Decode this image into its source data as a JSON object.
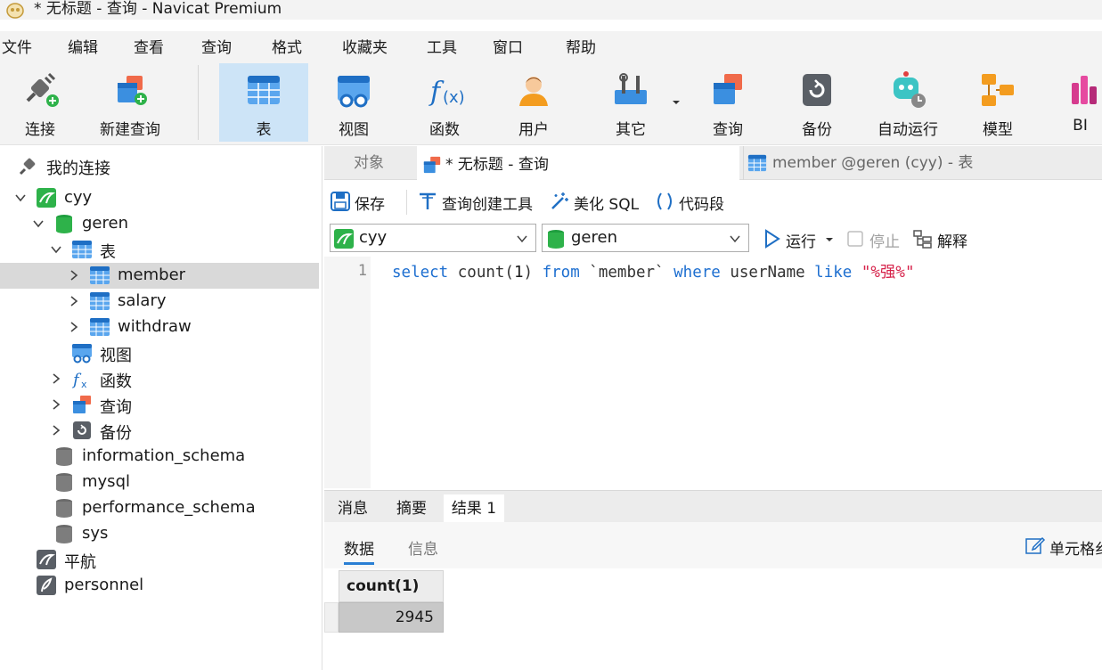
{
  "window": {
    "title": "* 无标题 - 查询 - Navicat Premium"
  },
  "menu": [
    "文件",
    "编辑",
    "查看",
    "查询",
    "格式",
    "收藏夹",
    "工具",
    "窗口",
    "帮助"
  ],
  "toolbar": {
    "connect": "连接",
    "new_query": "新建查询",
    "table": "表",
    "view": "视图",
    "function": "函数",
    "user": "用户",
    "other": "其它",
    "query": "查询",
    "backup": "备份",
    "automation": "自动运行",
    "model": "模型",
    "bi": "BI"
  },
  "sidebar": {
    "header": "我的连接",
    "connection": "cyy",
    "database": "geren",
    "tables_group": "表",
    "tables": [
      "member",
      "salary",
      "withdraw"
    ],
    "views": "视图",
    "functions": "函数",
    "queries": "查询",
    "backups": "备份",
    "other_dbs": [
      "information_schema",
      "mysql",
      "performance_schema",
      "sys"
    ],
    "other_connections": [
      "平航",
      "personnel"
    ]
  },
  "tabs": {
    "objects": "对象",
    "query": "* 无标题 - 查询",
    "member": "member @geren (cyy) - 表"
  },
  "query_toolbar": {
    "save": "保存",
    "builder": "查询创建工具",
    "beautify": "美化 SQL",
    "snippet": "代码段"
  },
  "selectors": {
    "connection": "cyy",
    "database": "geren",
    "run": "运行",
    "stop": "停止",
    "explain": "解释"
  },
  "editor": {
    "line_number": "1",
    "kw_select": "select",
    "fn_count": " count(",
    "arg": "1",
    "close": ") ",
    "kw_from": "from",
    "table_ref": " `member` ",
    "kw_where": "where",
    "column": " userName ",
    "kw_like": "like",
    "pattern": " \"%强%\""
  },
  "result_tabs": [
    "消息",
    "摘要",
    "结果 1"
  ],
  "result_subtabs": {
    "data": "数据",
    "info": "信息",
    "cell_format": "单元格纟"
  },
  "result": {
    "column": "count(1)",
    "value": "2945"
  },
  "colors": {
    "accent": "#2a7fd4",
    "keyword": "#1e6fd0",
    "string": "#d6224a",
    "selected_toolbar": "#cde4f7"
  }
}
